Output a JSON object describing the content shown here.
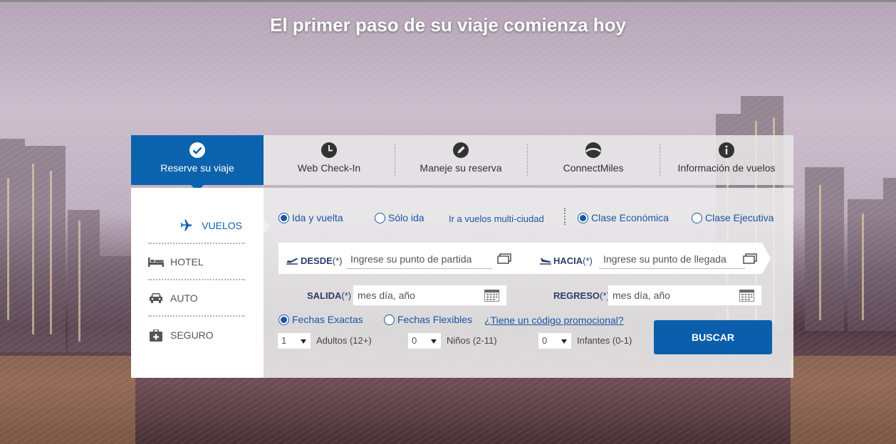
{
  "hero": {
    "title": "El primer paso de su viaje comienza hoy"
  },
  "tabs": [
    {
      "label": "Reserve su viaje",
      "icon": "check-circle-icon",
      "active": true
    },
    {
      "label": "Web Check-In",
      "icon": "clock-icon"
    },
    {
      "label": "Maneje su reserva",
      "icon": "pencil-icon"
    },
    {
      "label": "ConnectMiles",
      "icon": "connectmiles-logo-icon"
    },
    {
      "label": "Información de vuelos",
      "icon": "info-icon"
    }
  ],
  "nav": [
    {
      "label": "VUELOS",
      "icon": "airplane-icon",
      "active": true
    },
    {
      "label": "HOTEL",
      "icon": "bed-icon"
    },
    {
      "label": "AUTO",
      "icon": "car-icon"
    },
    {
      "label": "SEGURO",
      "icon": "medical-kit-icon"
    }
  ],
  "trip": {
    "roundtrip": "Ida y vuelta",
    "oneway": "Sólo ida",
    "multicity": "Ir a vuelos multi-ciudad",
    "economy": "Clase Económica",
    "business": "Clase Ejecutiva",
    "selected_trip": "roundtrip",
    "selected_class": "economy"
  },
  "from": {
    "label": "DESDE",
    "req": "(*)",
    "placeholder": "Ingrese su punto de partida"
  },
  "to": {
    "label": "HACIA",
    "req": "(*)",
    "placeholder": "Ingrese su punto de llegada"
  },
  "depart": {
    "label": "SALIDA",
    "req": "(*)",
    "placeholder": "mes día, año"
  },
  "return": {
    "label": "REGRESO",
    "req": "(*)",
    "placeholder": "mes día, año"
  },
  "dates": {
    "exact": "Fechas Exactas",
    "flexible": "Fechas Flexibles",
    "promo": "¿Tiene un código promocional?"
  },
  "passengers": [
    {
      "value": "1",
      "label": "Adultos (12+)"
    },
    {
      "value": "0",
      "label": "Niños (2-11)"
    },
    {
      "value": "0",
      "label": "Infantes (0-1)"
    }
  ],
  "search_button": "BUSCAR",
  "colors": {
    "primary": "#0b63ae",
    "link": "#1b56a5",
    "label_dark": "#2d3c6b"
  }
}
